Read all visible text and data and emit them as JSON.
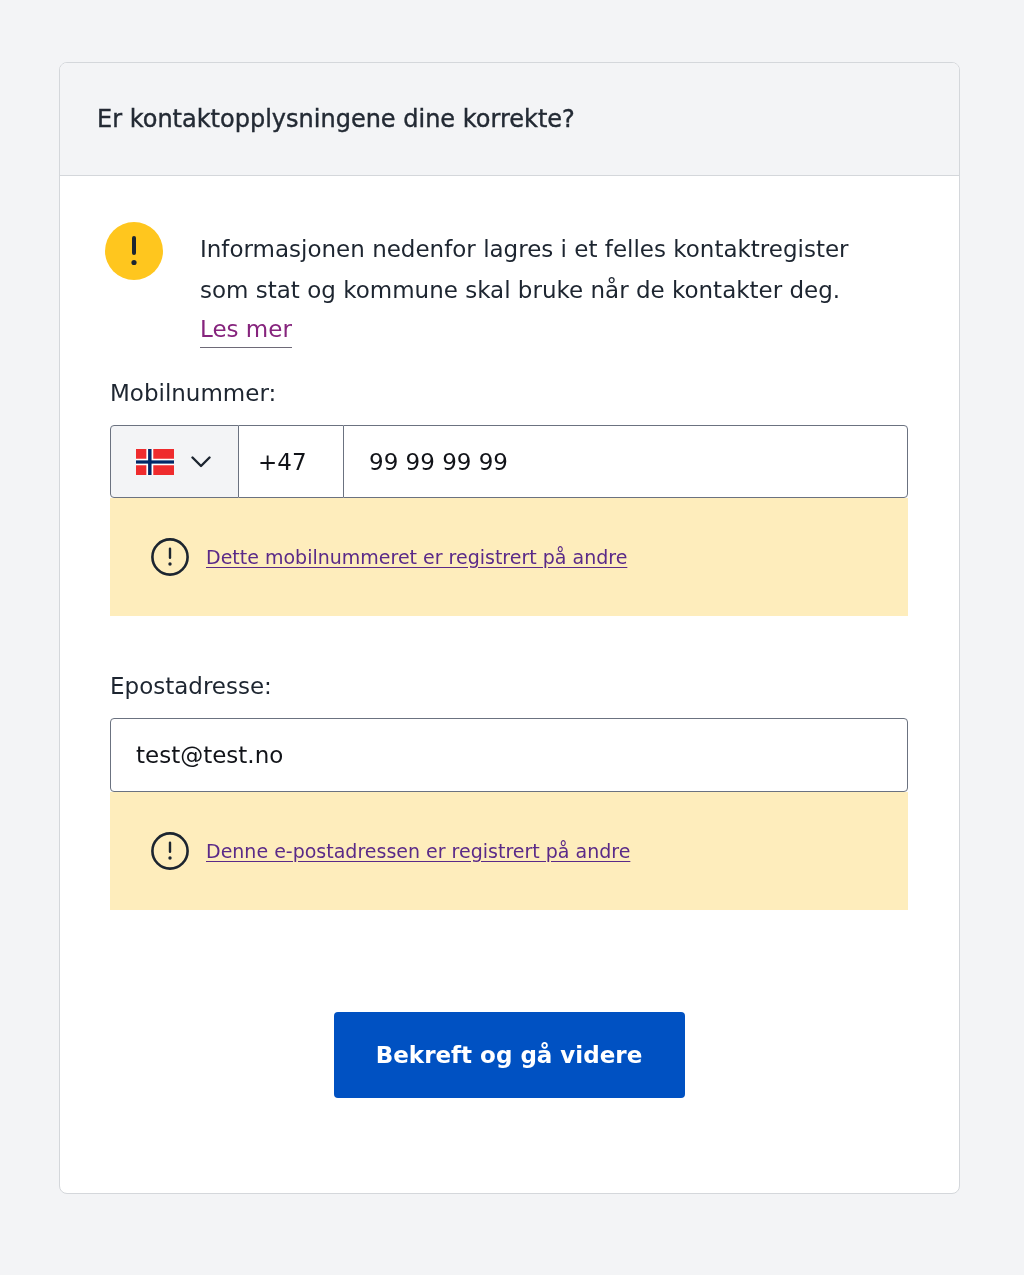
{
  "header": {
    "title": "Er kontaktopplysningene dine korrekte?"
  },
  "notice": {
    "text": "Informasjonen nedenfor lagres i et felles kontaktregister som stat og kommune skal bruke når de kontakter deg.",
    "link": "Les mer"
  },
  "fields": [
    {
      "kind": "phone",
      "label": "Mobilnummer:",
      "country_code": "+47",
      "value": "99 99 99 99",
      "warning": "Dette mobilnummeret er registrert på andre"
    },
    {
      "kind": "email",
      "label": "Epostadresse:",
      "value": "test@test.no",
      "warning": "Denne e-postadressen er registrert på andre"
    }
  ],
  "submit_button": {
    "label": "Bekreft og gå videre"
  }
}
